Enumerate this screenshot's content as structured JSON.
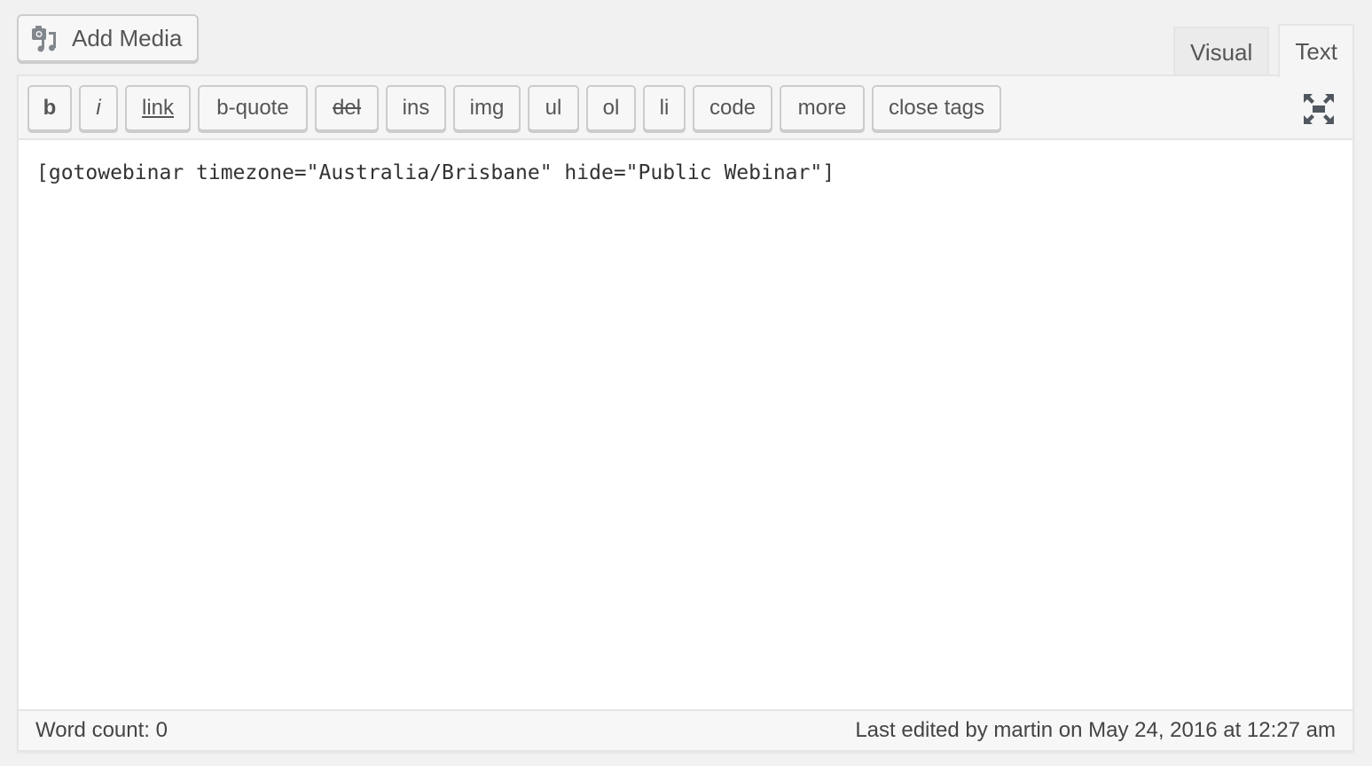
{
  "add_media": {
    "label": "Add Media",
    "icon": "media-camera-music-icon"
  },
  "tabs": [
    {
      "label": "Visual",
      "active": false
    },
    {
      "label": "Text",
      "active": true
    }
  ],
  "toolbar": {
    "buttons": [
      {
        "id": "b",
        "label": "b"
      },
      {
        "id": "i",
        "label": "i"
      },
      {
        "id": "link",
        "label": "link"
      },
      {
        "id": "b-quote",
        "label": "b-quote"
      },
      {
        "id": "del",
        "label": "del"
      },
      {
        "id": "ins",
        "label": "ins"
      },
      {
        "id": "img",
        "label": "img"
      },
      {
        "id": "ul",
        "label": "ul"
      },
      {
        "id": "ol",
        "label": "ol"
      },
      {
        "id": "li",
        "label": "li"
      },
      {
        "id": "code",
        "label": "code"
      },
      {
        "id": "more",
        "label": "more"
      },
      {
        "id": "close-tags",
        "label": "close tags"
      }
    ],
    "fullscreen_icon": "fullscreen-expand-icon"
  },
  "editor": {
    "content": "[gotowebinar timezone=\"Australia/Brisbane\" hide=\"Public Webinar\"]"
  },
  "status": {
    "word_count": "Word count: 0",
    "last_edited": "Last edited by martin on May 24, 2016 at 12:27 am"
  },
  "colors": {
    "icon": "#82878c",
    "fullscreen_icon": "#50575e",
    "border": "#cccccc",
    "background": "#f1f1f1"
  }
}
